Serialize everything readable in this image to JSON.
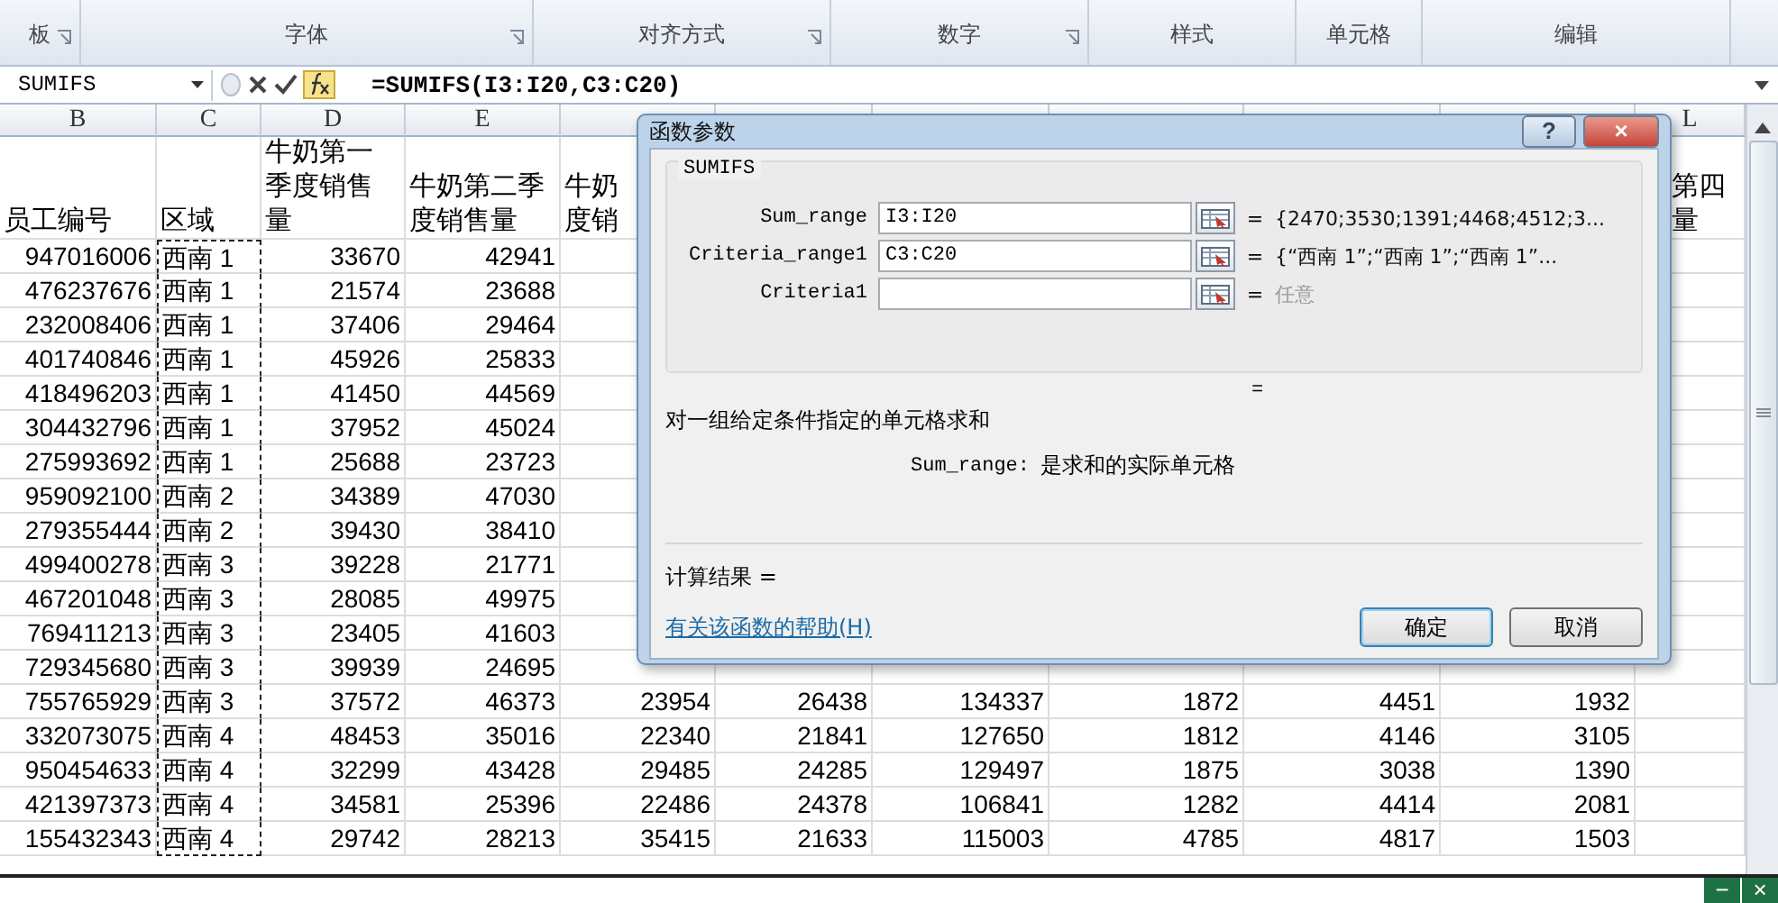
{
  "ribbon": {
    "groups": [
      {
        "label": "板",
        "launcher": true
      },
      {
        "label": "字体",
        "launcher": true
      },
      {
        "label": "对齐方式",
        "launcher": true
      },
      {
        "label": "数字",
        "launcher": true
      },
      {
        "label": "样式",
        "launcher": false
      },
      {
        "label": "单元格",
        "launcher": false
      },
      {
        "label": "编辑",
        "launcher": false
      }
    ]
  },
  "formula_bar": {
    "name_box": "SUMIFS",
    "formula": "=SUMIFS(I3:I20,C3:C20)"
  },
  "sheet": {
    "column_letters": [
      "B",
      "C",
      "D",
      "E",
      "L"
    ],
    "header_cells": [
      [
        "员工编号"
      ],
      [
        "区域"
      ],
      [
        "牛奶第一",
        "季度销售",
        "量"
      ],
      [
        "牛奶第二季",
        "度销售量"
      ],
      [
        "牛奶",
        "度销"
      ],
      [
        "第四",
        "量"
      ]
    ],
    "rows": [
      {
        "employee_id": "947016006",
        "region": "西南 1",
        "q1": "33670",
        "q2": "42941"
      },
      {
        "employee_id": "476237676",
        "region": "西南 1",
        "q1": "21574",
        "q2": "23688"
      },
      {
        "employee_id": "232008406",
        "region": "西南 1",
        "q1": "37406",
        "q2": "29464"
      },
      {
        "employee_id": "401740846",
        "region": "西南 1",
        "q1": "45926",
        "q2": "25833"
      },
      {
        "employee_id": "418496203",
        "region": "西南 1",
        "q1": "41450",
        "q2": "44569"
      },
      {
        "employee_id": "304432796",
        "region": "西南 1",
        "q1": "37952",
        "q2": "45024"
      },
      {
        "employee_id": "275993692",
        "region": "西南 1",
        "q1": "25688",
        "q2": "23723"
      },
      {
        "employee_id": "959092100",
        "region": "西南 2",
        "q1": "34389",
        "q2": "47030"
      },
      {
        "employee_id": "279355444",
        "region": "西南 2",
        "q1": "39430",
        "q2": "38410"
      },
      {
        "employee_id": "499400278",
        "region": "西南 3",
        "q1": "39228",
        "q2": "21771"
      },
      {
        "employee_id": "467201048",
        "region": "西南 3",
        "q1": "28085",
        "q2": "49975"
      },
      {
        "employee_id": "769411213",
        "region": "西南 3",
        "q1": "23405",
        "q2": "41603"
      },
      {
        "employee_id": "729345680",
        "region": "西南 3",
        "q1": "39939",
        "q2": "24695"
      },
      {
        "employee_id": "755765929",
        "region": "西南 3",
        "q1": "37572",
        "q2": "46373",
        "more": [
          "23954",
          "26438",
          "134337",
          "1872",
          "4451",
          "1932"
        ]
      },
      {
        "employee_id": "332073075",
        "region": "西南 4",
        "q1": "48453",
        "q2": "35016",
        "more": [
          "22340",
          "21841",
          "127650",
          "1812",
          "4146",
          "3105"
        ]
      },
      {
        "employee_id": "950454633",
        "region": "西南 4",
        "q1": "32299",
        "q2": "43428",
        "more": [
          "29485",
          "24285",
          "129497",
          "1875",
          "3038",
          "1390"
        ]
      },
      {
        "employee_id": "421397373",
        "region": "西南 4",
        "q1": "34581",
        "q2": "25396",
        "more": [
          "22486",
          "24378",
          "106841",
          "1282",
          "4414",
          "2081"
        ]
      },
      {
        "employee_id": "155432343",
        "region": "西南 4",
        "q1": "29742",
        "q2": "28213",
        "more": [
          "35415",
          "21633",
          "115003",
          "4785",
          "4817",
          "1503"
        ]
      }
    ]
  },
  "dialog": {
    "title": "函数参数",
    "help_button": "?",
    "close_button": "×",
    "function_name": "SUMIFS",
    "arguments": [
      {
        "label": "Sum_range",
        "value": "I3:I20",
        "equals": "=",
        "result": "{2470;3530;1391;4468;4512;3...",
        "greyed": false
      },
      {
        "label": "Criteria_range1",
        "value": "C3:C20",
        "equals": "=",
        "result": "{“西南 1”;“西南 1”;“西南 1”...",
        "greyed": false
      },
      {
        "label": "Criteria1",
        "equals": "=",
        "result": "任意",
        "greyed": true
      }
    ],
    "formula_result": "=",
    "description": "对一组给定条件指定的单元格求和",
    "arg_help": {
      "name": "Sum_range:",
      "text": "是求和的实际单元格"
    },
    "result_label": "计算结果 =",
    "help_link": "有关该函数的帮助(H)",
    "buttons": [
      {
        "label": "确定",
        "default": true
      },
      {
        "label": "取消",
        "default": false
      }
    ]
  },
  "window_buttons": [
    "−",
    "×"
  ]
}
